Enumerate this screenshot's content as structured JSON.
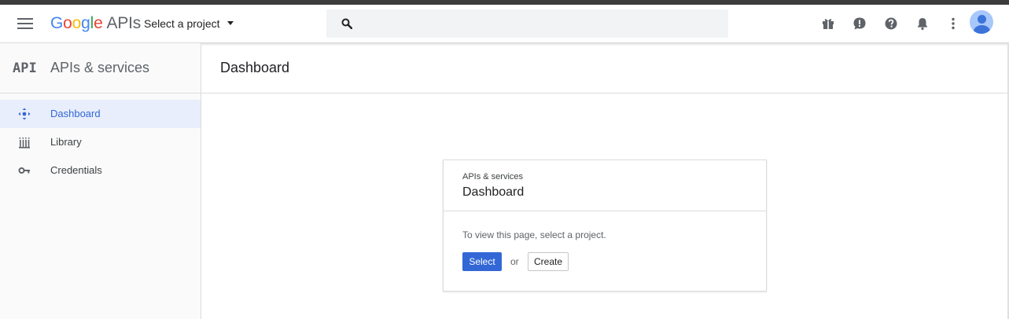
{
  "header": {
    "logo": {
      "letters": [
        {
          "ch": "G",
          "color": "#4285F4"
        },
        {
          "ch": "o",
          "color": "#EA4335"
        },
        {
          "ch": "o",
          "color": "#FBBC05"
        },
        {
          "ch": "g",
          "color": "#4285F4"
        },
        {
          "ch": "l",
          "color": "#34A853"
        },
        {
          "ch": "e",
          "color": "#EA4335"
        }
      ],
      "suffix": "APIs"
    },
    "project_selector": "Select a project",
    "search": {
      "placeholder": "",
      "value": ""
    },
    "icons": [
      "gift-icon",
      "feedback-icon",
      "help-icon",
      "notifications-icon",
      "more-vert-icon",
      "avatar"
    ]
  },
  "sidebar": {
    "badge": "API",
    "title": "APIs & services",
    "items": [
      {
        "label": "Dashboard",
        "icon": "dashboard-icon",
        "active": true
      },
      {
        "label": "Library",
        "icon": "library-icon",
        "active": false
      },
      {
        "label": "Credentials",
        "icon": "key-icon",
        "active": false
      }
    ]
  },
  "main": {
    "title": "Dashboard",
    "card": {
      "kicker": "APIs & services",
      "title": "Dashboard",
      "message": "To view this page, select a project.",
      "select_label": "Select",
      "or_label": "or",
      "create_label": "Create"
    }
  },
  "colors": {
    "accent": "#3367D6",
    "active_bg": "#E8EEFB",
    "topstrip": "#3C3C3C"
  }
}
